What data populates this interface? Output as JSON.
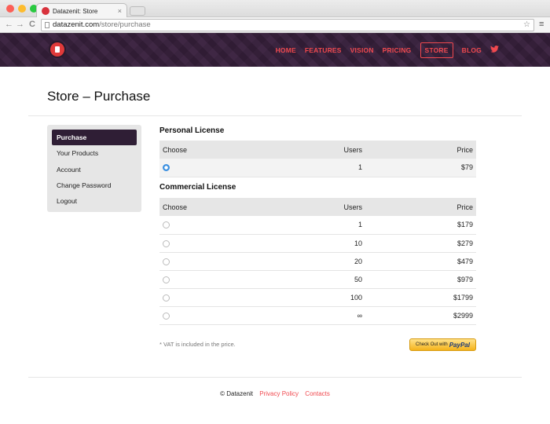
{
  "browser": {
    "tab_title": "Datazenit: Store",
    "tab_close": "×",
    "url_host": "datazenit.com",
    "url_path": "/store/purchase",
    "back": "←",
    "forward": "→",
    "reload": "C",
    "star": "☆",
    "menu": "≡"
  },
  "nav": {
    "home": "HOME",
    "features": "FEATURES",
    "vision": "VISION",
    "pricing": "PRICING",
    "store": "STORE",
    "blog": "BLOG"
  },
  "page_title": "Store – Purchase",
  "sidebar": {
    "items": [
      "Purchase",
      "Your Products",
      "Account",
      "Change Password",
      "Logout"
    ]
  },
  "personal": {
    "title": "Personal License",
    "headers": {
      "choose": "Choose",
      "users": "Users",
      "price": "Price"
    },
    "rows": [
      {
        "users": "1",
        "price": "$79"
      }
    ]
  },
  "commercial": {
    "title": "Commercial License",
    "headers": {
      "choose": "Choose",
      "users": "Users",
      "price": "Price"
    },
    "rows": [
      {
        "users": "1",
        "price": "$179"
      },
      {
        "users": "10",
        "price": "$279"
      },
      {
        "users": "20",
        "price": "$479"
      },
      {
        "users": "50",
        "price": "$979"
      },
      {
        "users": "100",
        "price": "$1799"
      },
      {
        "users": "∞",
        "price": "$2999"
      }
    ]
  },
  "vat_note": "* VAT is included in the price.",
  "paypal": {
    "prefix": "Check Out with",
    "brand": "PayPal"
  },
  "footer": {
    "copyright": "© Datazenit",
    "privacy": "Privacy Policy",
    "contacts": "Contacts"
  },
  "colors": {
    "accent": "#f0494f",
    "header_bg": "#3b2340",
    "active_item": "#2f1e35"
  }
}
